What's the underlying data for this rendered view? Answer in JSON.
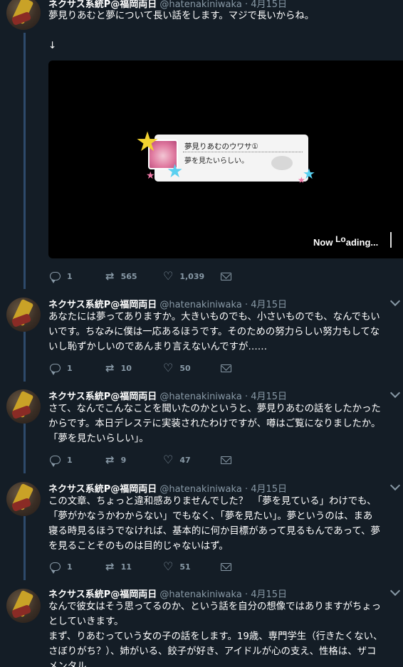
{
  "tweets": [
    {
      "name": "ネクサス系統P@福岡両日",
      "handle": "@hatenakiniwaka",
      "dot": "·",
      "date": "4月15日",
      "lines": [
        "夢見りあむと夢について長い話をします。マジで長いからね。",
        "",
        "↓"
      ],
      "media": {
        "card_title": "夢見りあむのウワサ①",
        "card_text": "夢を見たいらしい。",
        "loading_a": "Now ",
        "loading_b": "Lo",
        "loading_c": "ading..."
      },
      "replies": "1",
      "retweets": "565",
      "likes": "1,039"
    },
    {
      "name": "ネクサス系統P@福岡両日",
      "handle": "@hatenakiniwaka",
      "dot": "·",
      "date": "4月15日",
      "lines": [
        "あなたには夢ってありますか。大きいものでも、小さいものでも、なんでもい",
        "いです。ちなみに僕は一応あるほうです。そのための努力らしい努力もしてな",
        "いし恥ずかしいのであんまり言えないんですが……"
      ],
      "replies": "1",
      "retweets": "10",
      "likes": "50"
    },
    {
      "name": "ネクサス系統P@福岡両日",
      "handle": "@hatenakiniwaka",
      "dot": "·",
      "date": "4月15日",
      "lines": [
        "さて、なんでこんなことを聞いたのかというと、夢見りあむの話をしたかった",
        "からです。本日デレステに実装されたわけですが、噂はご覧になりましたか。",
        "「夢を見たいらしい」。"
      ],
      "replies": "1",
      "retweets": "9",
      "likes": "47"
    },
    {
      "name": "ネクサス系統P@福岡両日",
      "handle": "@hatenakiniwaka",
      "dot": "·",
      "date": "4月15日",
      "lines": [
        "この文章、ちょっと違和感ありませんでした？　「夢を見ている」わけでも、",
        "「夢がかなうかわからない」でもなく、「夢を見たい」。夢というのは、まあ",
        "寝る時見るほうでなければ、基本的に何か目標があって見るもんであって、夢",
        "を見ることそのものは目的じゃないはず。"
      ],
      "replies": "1",
      "retweets": "11",
      "likes": "51"
    },
    {
      "name": "ネクサス系統P@福岡両日",
      "handle": "@hatenakiniwaka",
      "dot": "·",
      "date": "4月15日",
      "lines": [
        "なんで彼女はそう思ってるのか、という話を自分の想像ではありますがちょっ",
        "としていきます。",
        "まず、りあむっていう女の子の話をします。19歳、専門学生（行きたくない、",
        "さぼりがち？）、姉がいる、餃子が好き、アイドルが心の支え、性格は、ザコ",
        "メンタル"
      ]
    }
  ],
  "colors": {
    "background": "#141d26",
    "text": "#ffffff",
    "muted": "#8899a6",
    "thread": "#2e4a6b"
  },
  "icons": [
    "reply-icon",
    "retweet-icon",
    "like-icon",
    "message-icon",
    "chevron-down-icon"
  ]
}
